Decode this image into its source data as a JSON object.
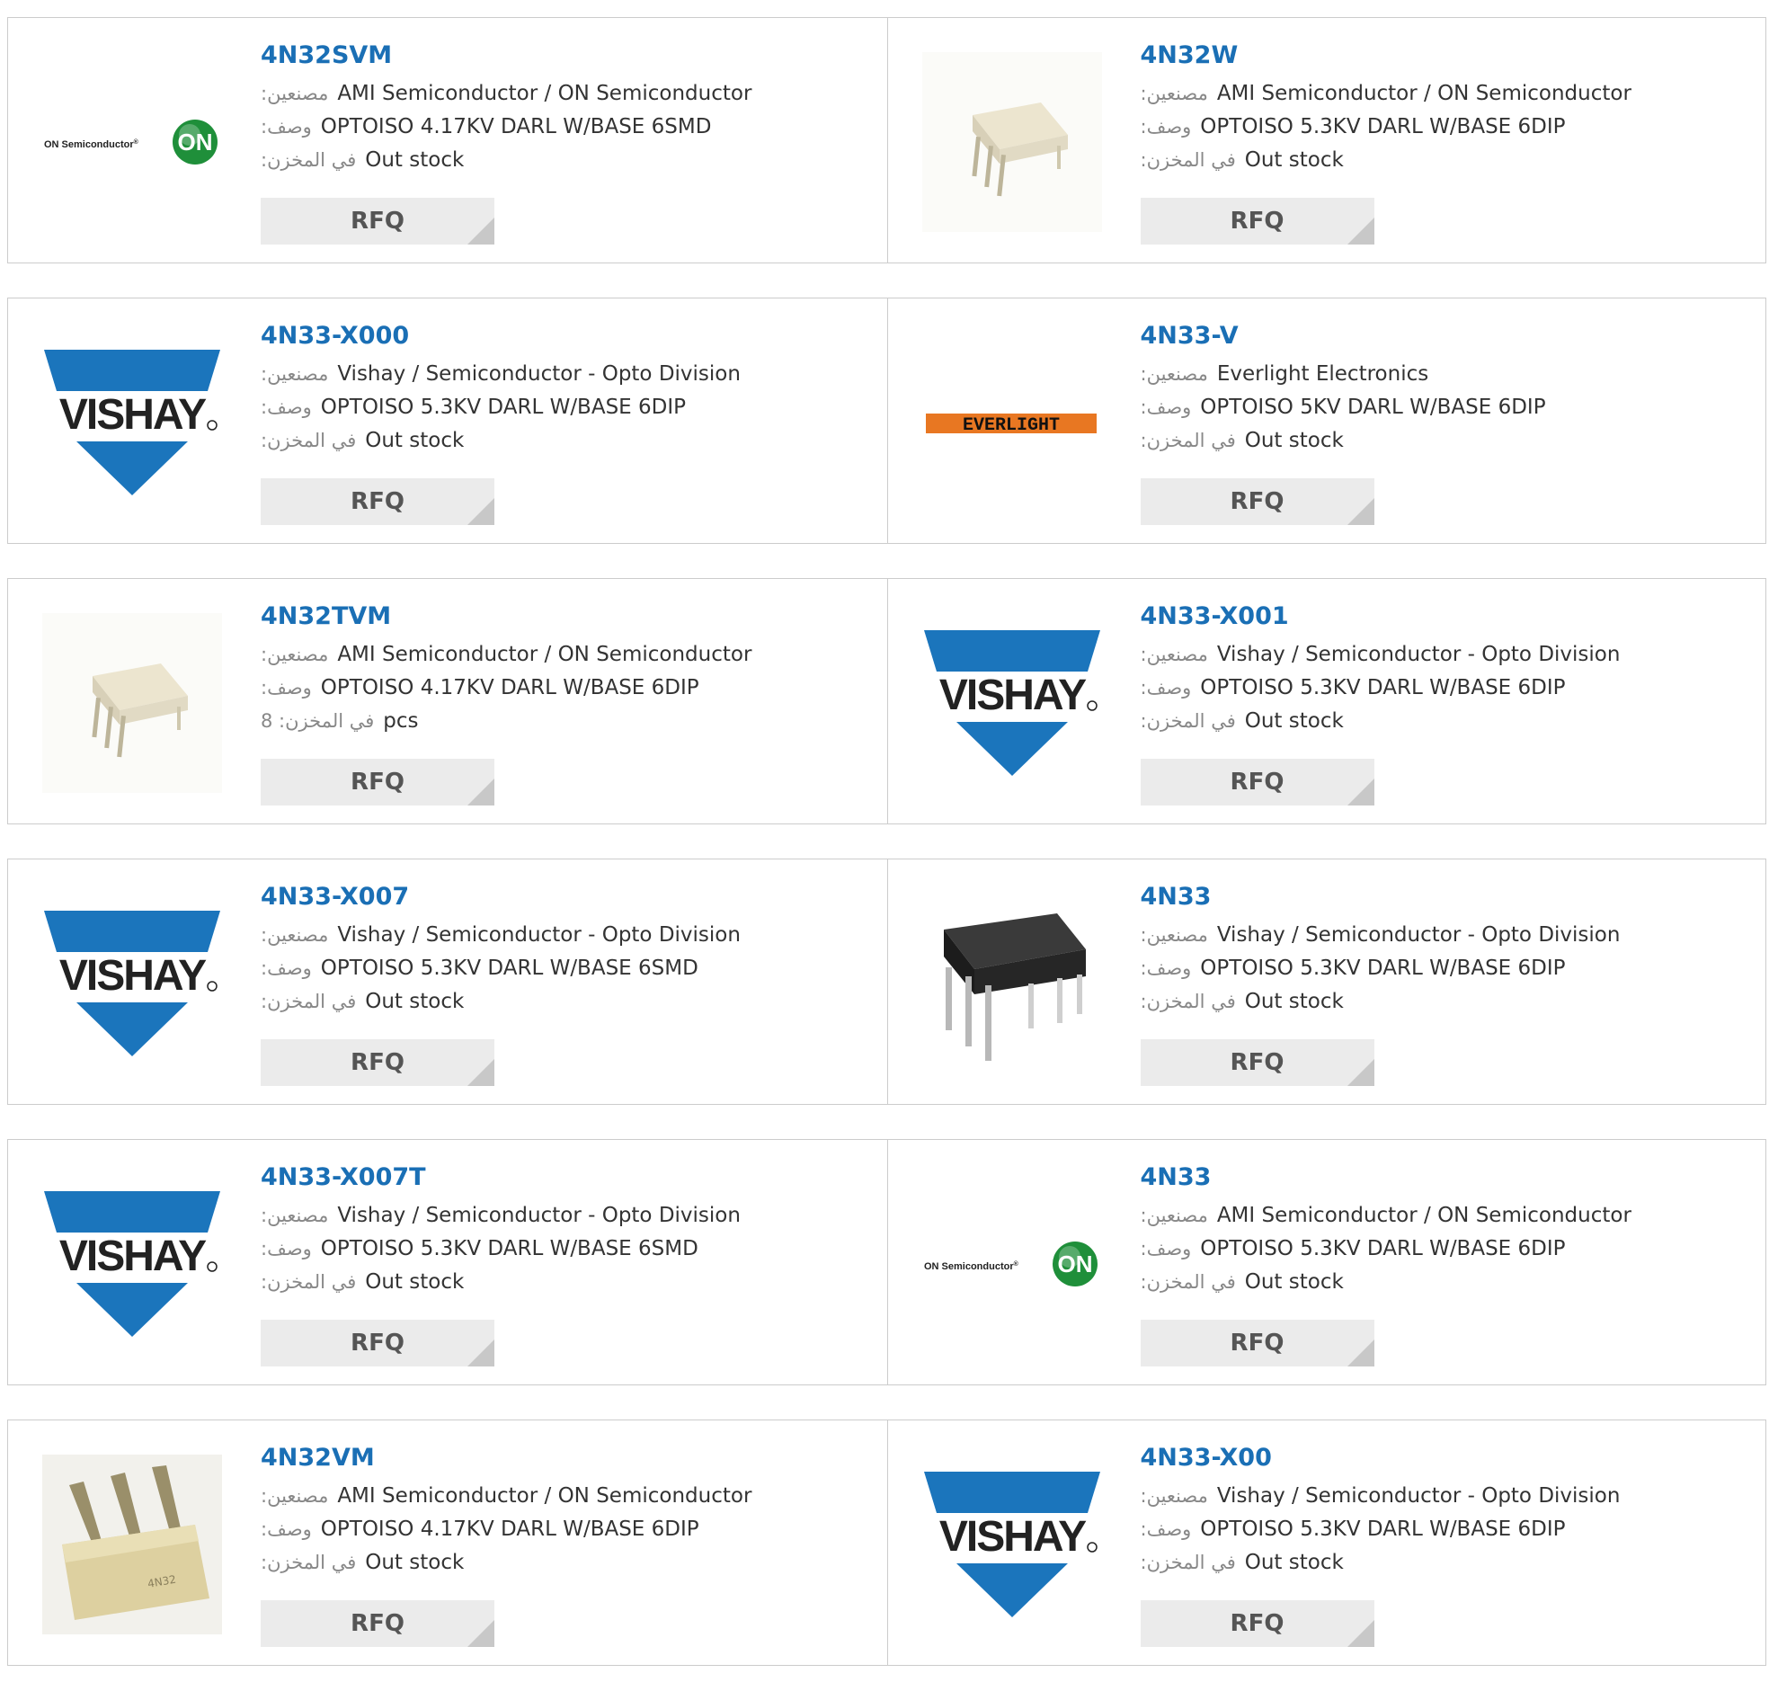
{
  "labels": {
    "manufacturer": ":مصنعين",
    "description": ":وصف",
    "stock": ":في المخزن",
    "stock_alt": "في المخزن: 8"
  },
  "brand_text": {
    "vishay": "VISHAY",
    "on_semi": "ON Semiconductor",
    "on_badge": "ON",
    "everlight": "EVERLIGHT"
  },
  "colors": {
    "part_link": "#1a6fb5",
    "vishay_blue": "#1b75bc",
    "on_green": "#1f8f3a",
    "everlight_orange": "#e87722",
    "rfq_bg": "#ebebeb"
  },
  "products": [
    {
      "part": "4N32SVM",
      "logo": "on-semi",
      "manufacturer": "AMI Semiconductor / ON Semiconductor",
      "description": "OPTOISO 4.17KV DARL W/BASE 6SMD",
      "stock": "Out stock",
      "rfq": "RFQ"
    },
    {
      "part": "4N32W",
      "logo": "chip-white",
      "manufacturer": "AMI Semiconductor / ON Semiconductor",
      "description": "OPTOISO 5.3KV DARL W/BASE 6DIP",
      "stock": "Out stock",
      "rfq": "RFQ"
    },
    {
      "part": "4N33-X000",
      "logo": "vishay",
      "manufacturer": "Vishay / Semiconductor - Opto Division",
      "description": "OPTOISO 5.3KV DARL W/BASE 6DIP",
      "stock": "Out stock",
      "rfq": "RFQ"
    },
    {
      "part": "4N33-V",
      "logo": "everlight",
      "manufacturer": "Everlight Electronics",
      "description": "OPTOISO 5KV DARL W/BASE 6DIP",
      "stock": "Out stock",
      "rfq": "RFQ"
    },
    {
      "part": "4N32TVM",
      "logo": "chip-white",
      "manufacturer": "AMI Semiconductor / ON Semiconductor",
      "description": "OPTOISO 4.17KV DARL W/BASE 6DIP",
      "stock": "pcs",
      "rfq": "RFQ",
      "alt_stock": true
    },
    {
      "part": "4N33-X001",
      "logo": "vishay",
      "manufacturer": "Vishay / Semiconductor - Opto Division",
      "description": "OPTOISO 5.3KV DARL W/BASE 6DIP",
      "stock": "Out stock",
      "rfq": "RFQ"
    },
    {
      "part": "4N33-X007",
      "logo": "vishay",
      "manufacturer": "Vishay / Semiconductor - Opto Division",
      "description": "OPTOISO 5.3KV DARL W/BASE 6SMD",
      "stock": "Out stock",
      "rfq": "RFQ"
    },
    {
      "part": "4N33",
      "logo": "chip-black",
      "manufacturer": "Vishay / Semiconductor - Opto Division",
      "description": "OPTOISO 5.3KV DARL W/BASE 6DIP",
      "stock": "Out stock",
      "rfq": "RFQ"
    },
    {
      "part": "4N33-X007T",
      "logo": "vishay",
      "manufacturer": "Vishay / Semiconductor - Opto Division",
      "description": "OPTOISO 5.3KV DARL W/BASE 6SMD",
      "stock": "Out stock",
      "rfq": "RFQ"
    },
    {
      "part": "4N33",
      "logo": "on-semi",
      "manufacturer": "AMI Semiconductor / ON Semiconductor",
      "description": "OPTOISO 5.3KV DARL W/BASE 6DIP",
      "stock": "Out stock",
      "rfq": "RFQ"
    },
    {
      "part": "4N32VM",
      "logo": "chip-beige",
      "manufacturer": "AMI Semiconductor / ON Semiconductor",
      "description": "OPTOISO 4.17KV DARL W/BASE 6DIP",
      "stock": "Out stock",
      "rfq": "RFQ"
    },
    {
      "part": "4N33-X00",
      "logo": "vishay",
      "manufacturer": "Vishay / Semiconductor - Opto Division",
      "description": "OPTOISO 5.3KV DARL W/BASE 6DIP",
      "stock": "Out stock",
      "rfq": "RFQ"
    }
  ]
}
